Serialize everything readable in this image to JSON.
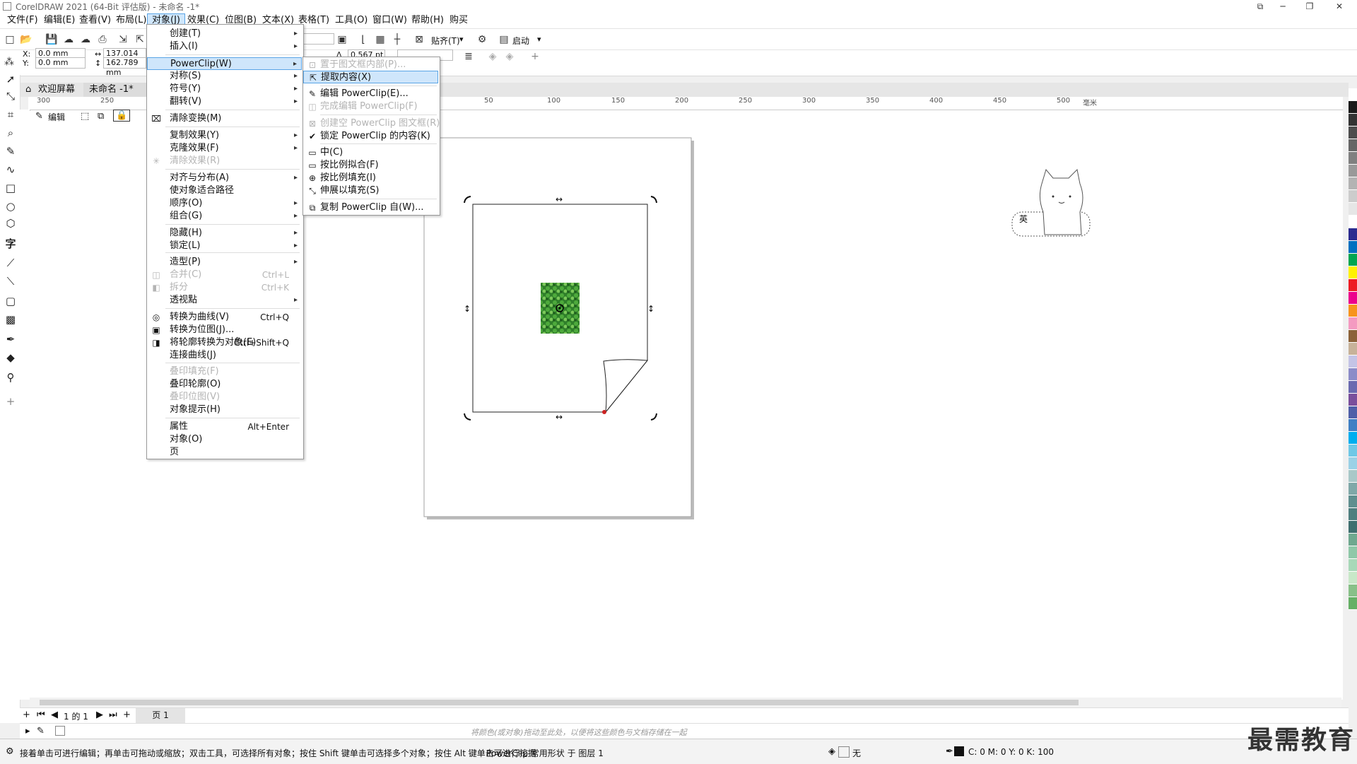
{
  "window": {
    "title": "CorelDRAW 2021 (64-Bit 评估版) - 未命名 -1*",
    "minimize": "─",
    "maximize": "❐",
    "close": "✕",
    "restore": "⧉"
  },
  "menubar": {
    "items": [
      "文件(F)",
      "编辑(E)",
      "查看(V)",
      "布局(L)",
      "对象(J)",
      "效果(C)",
      "位图(B)",
      "文本(X)",
      "表格(T)",
      "工具(O)",
      "窗口(W)",
      "帮助(H)",
      "购买"
    ],
    "active": "对象(J)"
  },
  "toolbar1": {
    "snap_label": "贴齐(T)",
    "launch_label": "启动"
  },
  "toolbar2": {
    "x_label": "X:",
    "y_label": "Y:",
    "x_value": "0.0 mm",
    "y_value": "0.0 mm",
    "width_value": "137.014 mm",
    "height_value": "162.789 mm",
    "outline_width": "0.567 pt"
  },
  "doc_tabs": {
    "home_icon": "home-icon",
    "welcome": "欢迎屏幕",
    "document": "未命名 -1*"
  },
  "hruler_ticks": [
    "300",
    "250",
    "50",
    "100",
    "150",
    "200",
    "250",
    "300",
    "350",
    "400",
    "450",
    "500",
    "毫米"
  ],
  "prop_docker": {
    "edit_label": "编辑"
  },
  "object_menu": {
    "items": [
      {
        "label": "创建(T)",
        "arrow": true
      },
      {
        "label": "插入(I)",
        "arrow": true
      },
      {
        "label": "PowerClip(W)",
        "arrow": true,
        "highlight": true
      },
      {
        "label": "对称(S)",
        "arrow": true
      },
      {
        "label": "符号(Y)",
        "arrow": true
      },
      {
        "label": "翻转(V)",
        "arrow": true
      },
      {
        "label": "清除变换(M)"
      },
      {
        "label": "复制效果(Y)",
        "arrow": true
      },
      {
        "label": "克隆效果(F)",
        "arrow": true
      },
      {
        "label": "清除效果(R)",
        "disabled": true
      },
      {
        "label": "对齐与分布(A)",
        "arrow": true
      },
      {
        "label": "使对象适合路径"
      },
      {
        "label": "顺序(O)",
        "arrow": true
      },
      {
        "label": "组合(G)",
        "arrow": true
      },
      {
        "label": "隐藏(H)",
        "arrow": true
      },
      {
        "label": "锁定(L)",
        "arrow": true
      },
      {
        "label": "造型(P)",
        "arrow": true
      },
      {
        "label": "合并(C)",
        "shortcut": "Ctrl+L",
        "disabled": true
      },
      {
        "label": "拆分",
        "shortcut": "Ctrl+K",
        "disabled": true
      },
      {
        "label": "透视點",
        "arrow": true
      },
      {
        "label": "转换为曲线(V)",
        "shortcut": "Ctrl+Q"
      },
      {
        "label": "转换为位图(J)..."
      },
      {
        "label": "将轮廓转换为对象(E)",
        "shortcut": "Ctrl+Shift+Q"
      },
      {
        "label": "连接曲线(J)"
      },
      {
        "label": "叠印填充(F)",
        "disabled": true
      },
      {
        "label": "叠印轮廓(O)"
      },
      {
        "label": "叠印位图(V)",
        "disabled": true
      },
      {
        "label": "对象提示(H)"
      },
      {
        "label": "属性",
        "shortcut": "Alt+Enter"
      },
      {
        "label": "对象(O)"
      },
      {
        "label": "页"
      }
    ]
  },
  "powerclip_menu": {
    "items": [
      {
        "label": "置于图文框内部(P)...",
        "disabled": true
      },
      {
        "label": "提取内容(X)",
        "highlight": true
      },
      {
        "label": "编辑 PowerClip(E)..."
      },
      {
        "label": "完成编辑 PowerClip(F)",
        "disabled": true
      },
      {
        "label": "创建空 PowerClip 图文框(R)",
        "disabled": true
      },
      {
        "label": "锁定 PowerClip 的内容(K)",
        "checked": true
      },
      {
        "label": "中(C)"
      },
      {
        "label": "按比例拟合(F)"
      },
      {
        "label": "按比例填充(I)"
      },
      {
        "label": "伸展以填充(S)"
      },
      {
        "label": "复制 PowerClip 自(W)..."
      }
    ]
  },
  "ime": {
    "label": "英"
  },
  "pagebar": {
    "page_counter": "1 的 1",
    "page_tab": "页 1"
  },
  "colorbar": {
    "hint": "将颜色(或对象)拖动至此处，以便将这些颜色与文档存储在一起"
  },
  "status": {
    "message": "接着单击可进行编辑；再单击可拖动或缩放；双击工具，可选择所有对象；按住 Shift 键单击可选择多个对象；按住 Alt 键单击可进行挖掘",
    "object_info": "PowerClip 常用形状 于 图层 1",
    "fill_label": "无",
    "cmyk": "C: 0 M: 0 Y: 0 K: 100"
  },
  "watermark": "最需教育",
  "palette_colors": [
    "#ffffff",
    "#1a1a1a",
    "#333333",
    "#4d4d4d",
    "#666666",
    "#808080",
    "#999999",
    "#b3b3b3",
    "#cccccc",
    "#e6e6e6",
    "#ffffff",
    "#2b2b8f",
    "#0070c0",
    "#00a651",
    "#fff200",
    "#ed1c24",
    "#ec008c",
    "#f7941d",
    "#f49ac1",
    "#8c6239",
    "#c7b299",
    "#c4c4e6",
    "#8c8cc8",
    "#6a6ab0",
    "#7a4f9c",
    "#4f5fa8",
    "#3f7fc4",
    "#00aeef",
    "#6fc8e6",
    "#9bd1e6",
    "#a8c8c8",
    "#7fa8a8",
    "#5f8f8f",
    "#4f7f7f",
    "#3f6f6f",
    "#6fa88f",
    "#8fc8a8",
    "#a8d8b8",
    "#c8e8c8",
    "#88c088",
    "#66b066"
  ]
}
